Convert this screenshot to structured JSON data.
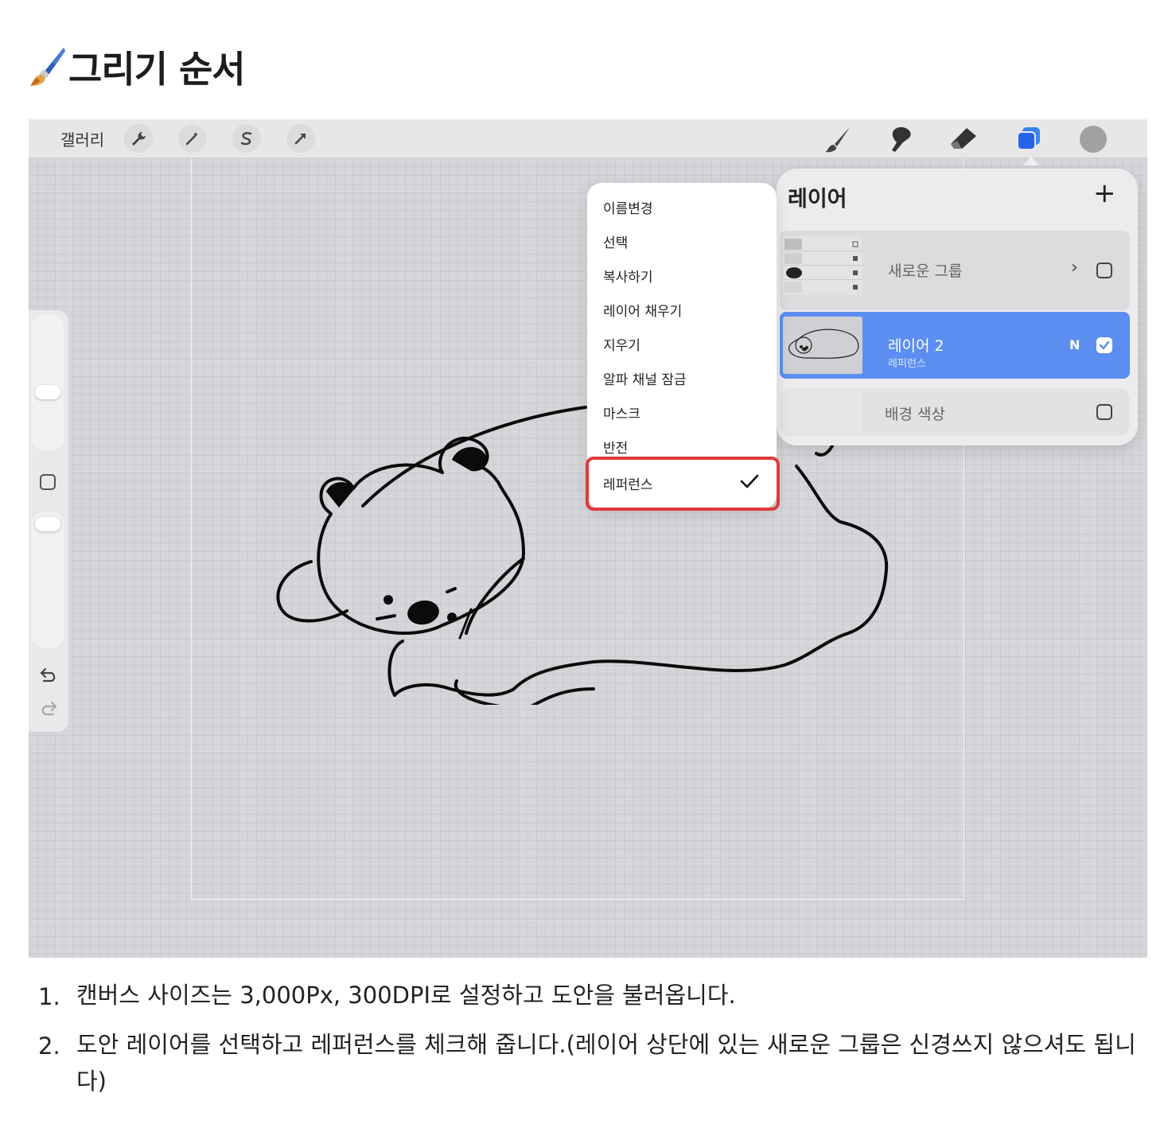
{
  "heading": {
    "icon": "paintbrush-icon",
    "title": "그리기 순서"
  },
  "toolbar": {
    "gallery_label": "갤러리",
    "left_tools": [
      "wrench-icon",
      "magic-wand-icon",
      "selection-s-icon",
      "arrow-transform-icon"
    ],
    "right_tools": [
      "brush-icon",
      "smudge-icon",
      "eraser-icon",
      "layers-icon"
    ],
    "color": "#a3a1a0",
    "accent": "#3b82f6"
  },
  "layers_panel": {
    "title": "레이어",
    "add_label": "+",
    "rows": [
      {
        "name": "새로운 그룹",
        "chevron": "›",
        "checked": false
      },
      {
        "name": "레이어 2",
        "subtitle": "레퍼런스",
        "blend": "N",
        "checked": true,
        "selected": true
      },
      {
        "name": "배경 색상",
        "checked": false
      }
    ]
  },
  "context_menu": {
    "items": [
      "이름변경",
      "선택",
      "복사하기",
      "레이어 채우기",
      "지우기",
      "알파 채널 잠금",
      "마스크",
      "반전",
      "레퍼런스"
    ],
    "checked_item": "레퍼런스",
    "highlight_color": "#e03a3a"
  },
  "steps": [
    {
      "num": "1.",
      "text": "캔버스 사이즈는 3,000Px, 300DPI로 설정하고 도안을 불러옵니다."
    },
    {
      "num": "2.",
      "text": "도안 레이어를 선택하고 레퍼런스를 체크해 줍니다.(레이어 상단에 있는 새로운 그룹은 신경쓰지 않으셔도 됩니다)"
    }
  ]
}
